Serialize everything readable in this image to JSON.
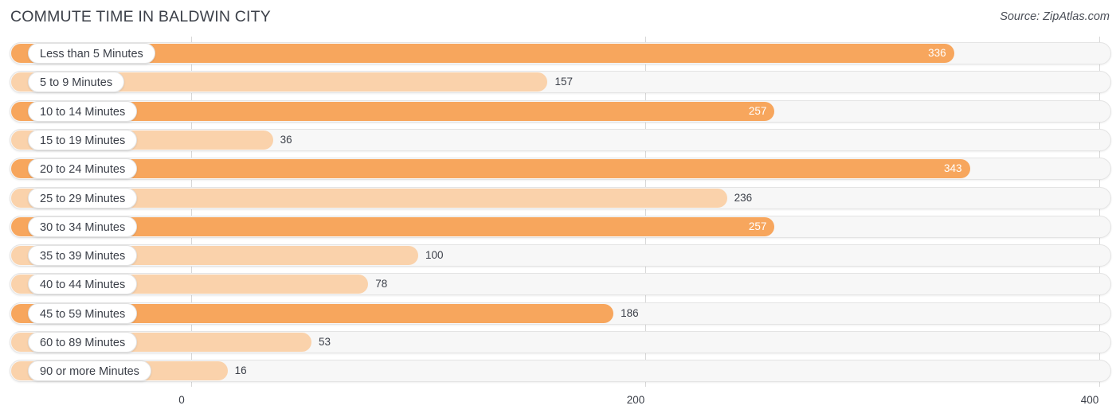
{
  "header": {
    "title": "COMMUTE TIME IN BALDWIN CITY",
    "source": "Source: ZipAtlas.com"
  },
  "colors": {
    "bar_strong": "#f7a65d",
    "bar_light": "#fad2ab",
    "track": "#f7f7f7",
    "track_border": "#e4e4e4",
    "gridline": "#d8d8d8",
    "text": "#3c4049",
    "value_in_bar": "#ffffff"
  },
  "chart_data": {
    "type": "bar",
    "orientation": "horizontal",
    "title": "COMMUTE TIME IN BALDWIN CITY",
    "xlabel": "",
    "ylabel": "",
    "xlim": [
      0,
      400
    ],
    "ticks": [
      "0",
      "200",
      "400"
    ],
    "tick_values": [
      0,
      200,
      400
    ],
    "grid": true,
    "legend": false,
    "categories": [
      "Less than 5 Minutes",
      "5 to 9 Minutes",
      "10 to 14 Minutes",
      "15 to 19 Minutes",
      "20 to 24 Minutes",
      "25 to 29 Minutes",
      "30 to 34 Minutes",
      "35 to 39 Minutes",
      "40 to 44 Minutes",
      "45 to 59 Minutes",
      "60 to 89 Minutes",
      "90 or more Minutes"
    ],
    "values": [
      336,
      157,
      257,
      36,
      343,
      236,
      257,
      100,
      78,
      186,
      53,
      16
    ],
    "value_labels": [
      "336",
      "157",
      "257",
      "36",
      "343",
      "236",
      "257",
      "100",
      "78",
      "186",
      "53",
      "16"
    ]
  },
  "rows": [
    {
      "label": "Less than 5 Minutes",
      "value": 336,
      "value_label": "336",
      "shade": "strong",
      "inside": true
    },
    {
      "label": "5 to 9 Minutes",
      "value": 157,
      "value_label": "157",
      "shade": "light",
      "inside": false
    },
    {
      "label": "10 to 14 Minutes",
      "value": 257,
      "value_label": "257",
      "shade": "strong",
      "inside": true
    },
    {
      "label": "15 to 19 Minutes",
      "value": 36,
      "value_label": "36",
      "shade": "light",
      "inside": false
    },
    {
      "label": "20 to 24 Minutes",
      "value": 343,
      "value_label": "343",
      "shade": "strong",
      "inside": true
    },
    {
      "label": "25 to 29 Minutes",
      "value": 236,
      "value_label": "236",
      "shade": "light",
      "inside": false
    },
    {
      "label": "30 to 34 Minutes",
      "value": 257,
      "value_label": "257",
      "shade": "strong",
      "inside": true
    },
    {
      "label": "35 to 39 Minutes",
      "value": 100,
      "value_label": "100",
      "shade": "light",
      "inside": false
    },
    {
      "label": "40 to 44 Minutes",
      "value": 78,
      "value_label": "78",
      "shade": "light",
      "inside": false
    },
    {
      "label": "45 to 59 Minutes",
      "value": 186,
      "value_label": "186",
      "shade": "strong",
      "inside": false
    },
    {
      "label": "60 to 89 Minutes",
      "value": 53,
      "value_label": "53",
      "shade": "light",
      "inside": false
    },
    {
      "label": "90 or more Minutes",
      "value": 16,
      "value_label": "16",
      "shade": "light",
      "inside": false
    }
  ],
  "axis": {
    "ticks": [
      {
        "label": "0",
        "value": 0
      },
      {
        "label": "200",
        "value": 200
      },
      {
        "label": "400",
        "value": 400
      }
    ]
  }
}
